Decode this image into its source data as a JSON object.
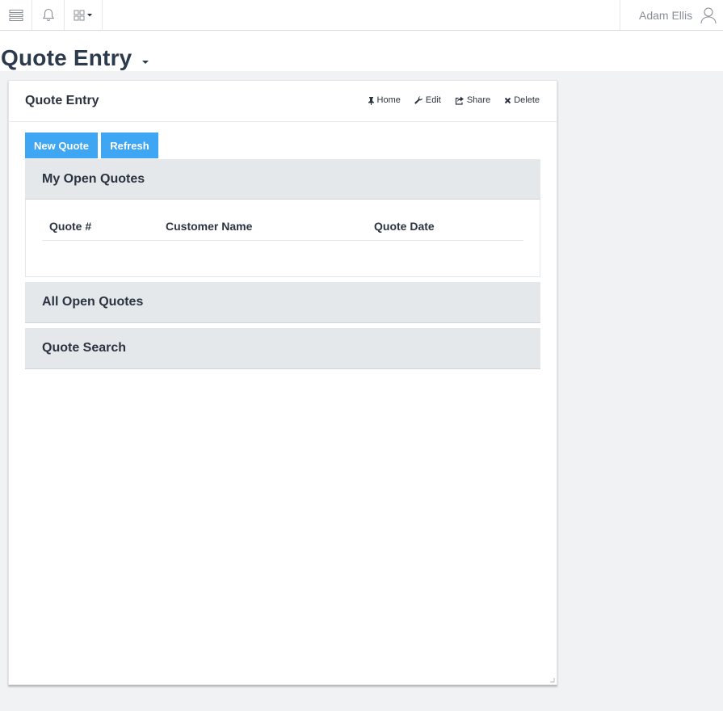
{
  "topbar": {
    "menu_icon": "menu-lines-icon",
    "bell_icon": "bell-icon",
    "apps_icon": "apps-grid-icon",
    "user_name": "Adam Ellis",
    "user_icon": "user-icon"
  },
  "page": {
    "title": "Quote Entry"
  },
  "panel": {
    "title": "Quote Entry",
    "actions": {
      "home": "Home",
      "edit": "Edit",
      "share": "Share",
      "delete": "Delete"
    },
    "buttons": {
      "new_quote": "New Quote",
      "refresh": "Refresh"
    },
    "sections": {
      "my_open_quotes": {
        "title": "My Open Quotes",
        "columns": [
          "Quote #",
          "Customer Name",
          "Quote Date"
        ],
        "rows": []
      },
      "all_open_quotes": {
        "title": "All Open Quotes"
      },
      "quote_search": {
        "title": "Quote Search"
      }
    }
  },
  "colors": {
    "accent": "#3ea6f2",
    "title": "#2c3a4e",
    "section_bg": "#e4e8eb",
    "page_bg": "#f1f2f4"
  }
}
